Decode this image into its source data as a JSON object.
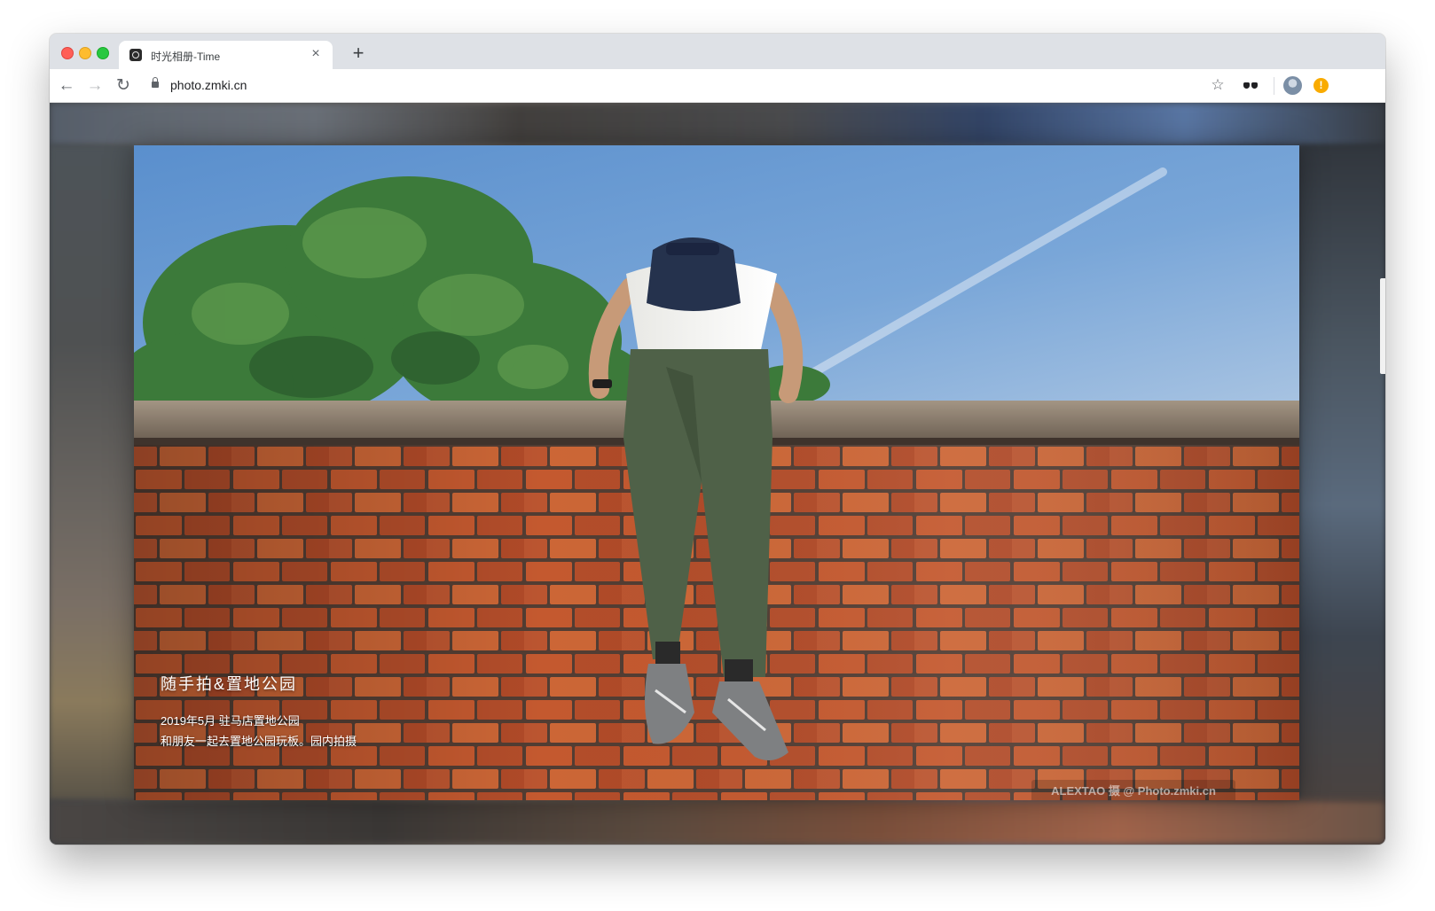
{
  "browser": {
    "tab": {
      "title": "时光相册-Time",
      "close_label": "×"
    },
    "new_tab_label": "+",
    "nav": {
      "back": "←",
      "forward": "→",
      "reload": "↻"
    },
    "address": {
      "url": "photo.zmki.cn"
    },
    "bookmark_label": "☆",
    "update_badge": "!"
  },
  "photo": {
    "title": "随手拍&置地公园",
    "description_line1": "2019年5月 驻马店置地公园",
    "description_line2": "和朋友一起去置地公园玩板。园内拍摄",
    "watermark": "ALEXTAO 摄 @ Photo.zmki.cn"
  },
  "colors": {
    "sky": "#6fa0d2",
    "wall_cap": "#8a7d6e",
    "brick": "#c25a36",
    "mortar": "#5a463c",
    "tree": "#3f7a3c",
    "pants": "#4f6148",
    "shirt": "#f2f2f0",
    "backpack": "#25324d"
  }
}
